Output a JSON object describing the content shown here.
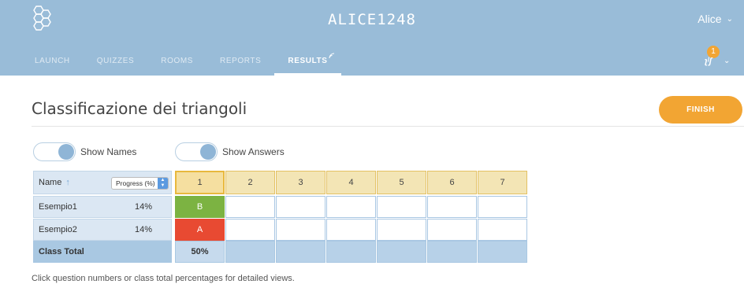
{
  "header": {
    "room_code": "ALICE1248",
    "user_name": "Alice",
    "notification_count": "1",
    "notification_label": "ʅˡʃ"
  },
  "nav": {
    "items": [
      {
        "label": "LAUNCH",
        "active": false
      },
      {
        "label": "QUIZZES",
        "active": false
      },
      {
        "label": "ROOMS",
        "active": false
      },
      {
        "label": "REPORTS",
        "active": false
      },
      {
        "label": "RESULTS",
        "active": true
      }
    ]
  },
  "page": {
    "title": "Classificazione dei triangoli",
    "finish_label": "FINISH"
  },
  "toggles": {
    "show_names": {
      "label": "Show Names",
      "on": true
    },
    "show_answers": {
      "label": "Show Answers",
      "on": true
    }
  },
  "grid": {
    "name_header": "Name",
    "sort_arrow": "↑",
    "progress_select": "Progress (%)",
    "questions": [
      "1",
      "2",
      "3",
      "4",
      "5",
      "6",
      "7"
    ],
    "rows": [
      {
        "name": "Esempio1",
        "progress": "14%",
        "answers": [
          "B",
          "",
          "",
          "",
          "",
          "",
          ""
        ],
        "q1_correct": true
      },
      {
        "name": "Esempio2",
        "progress": "14%",
        "answers": [
          "A",
          "",
          "",
          "",
          "",
          "",
          ""
        ],
        "q1_correct": false
      }
    ],
    "class_total_label": "Class Total",
    "class_totals": [
      "50%",
      "",
      "",
      "",
      "",
      "",
      ""
    ]
  },
  "footnote": "Click question numbers or class total percentages for detailed views.",
  "colors": {
    "topbar": "#99bcd8",
    "accent": "#f2a533",
    "correct": "#7cb342",
    "wrong": "#e84a32"
  }
}
